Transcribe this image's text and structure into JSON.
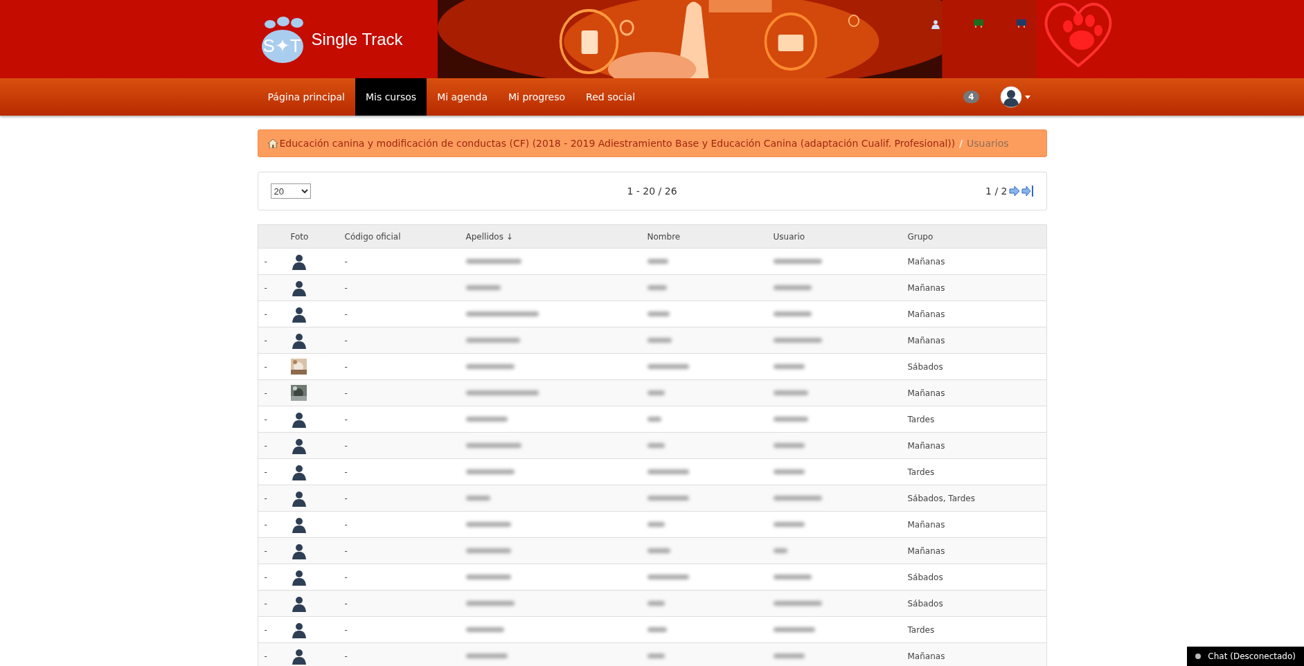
{
  "header": {
    "logo_letters": "S✦T",
    "brand": "Single Track"
  },
  "nav": {
    "items": [
      {
        "label": "Página principal",
        "selected": false
      },
      {
        "label": "Mis cursos",
        "selected": true
      },
      {
        "label": "Mi agenda",
        "selected": false
      },
      {
        "label": "Mi progreso",
        "selected": false
      },
      {
        "label": "Red social",
        "selected": false
      }
    ],
    "notifications": "4"
  },
  "breadcrumb": {
    "separator": "/",
    "items": [
      "Educación canina y modificación de conductas (CF) (2018 - 2019 Adiestramiento Base y Educación Canina (adaptación Cualif. Profesional))",
      "Usuarios"
    ]
  },
  "pager": {
    "page_size": "20",
    "range": "1 - 20 / 26",
    "page": "1 / 2"
  },
  "table": {
    "columns": [
      "Foto",
      "Código oficial",
      "Apellidos ↓",
      "Nombre",
      "Usuario",
      "Grupo"
    ],
    "rows": [
      {
        "mark": "-",
        "kind": "avatar",
        "code": "-",
        "group": "Mañanas"
      },
      {
        "mark": "-",
        "kind": "avatar",
        "code": "-",
        "group": "Mañanas"
      },
      {
        "mark": "-",
        "kind": "avatar",
        "code": "-",
        "group": "Mañanas"
      },
      {
        "mark": "-",
        "kind": "avatar",
        "code": "-",
        "group": "Mañanas"
      },
      {
        "mark": "-",
        "kind": "picture",
        "code": "-",
        "group": "Sábados"
      },
      {
        "mark": "-",
        "kind": "picture",
        "code": "-",
        "group": "Mañanas"
      },
      {
        "mark": "-",
        "kind": "avatar",
        "code": "-",
        "group": "Tardes"
      },
      {
        "mark": "-",
        "kind": "avatar",
        "code": "-",
        "group": "Mañanas"
      },
      {
        "mark": "-",
        "kind": "avatar",
        "code": "-",
        "group": "Tardes"
      },
      {
        "mark": "-",
        "kind": "avatar",
        "code": "-",
        "group": "Sábados, Tardes"
      },
      {
        "mark": "-",
        "kind": "avatar",
        "code": "-",
        "group": "Mañanas"
      },
      {
        "mark": "-",
        "kind": "avatar",
        "code": "-",
        "group": "Mañanas"
      },
      {
        "mark": "-",
        "kind": "avatar",
        "code": "-",
        "group": "Sábados"
      },
      {
        "mark": "-",
        "kind": "avatar",
        "code": "-",
        "group": "Sábados"
      },
      {
        "mark": "-",
        "kind": "avatar",
        "code": "-",
        "group": "Tardes"
      },
      {
        "mark": "-",
        "kind": "avatar",
        "code": "-",
        "group": "Mañanas"
      }
    ]
  },
  "chat": {
    "label": "Chat (Desconectado)",
    "connected": false
  }
}
